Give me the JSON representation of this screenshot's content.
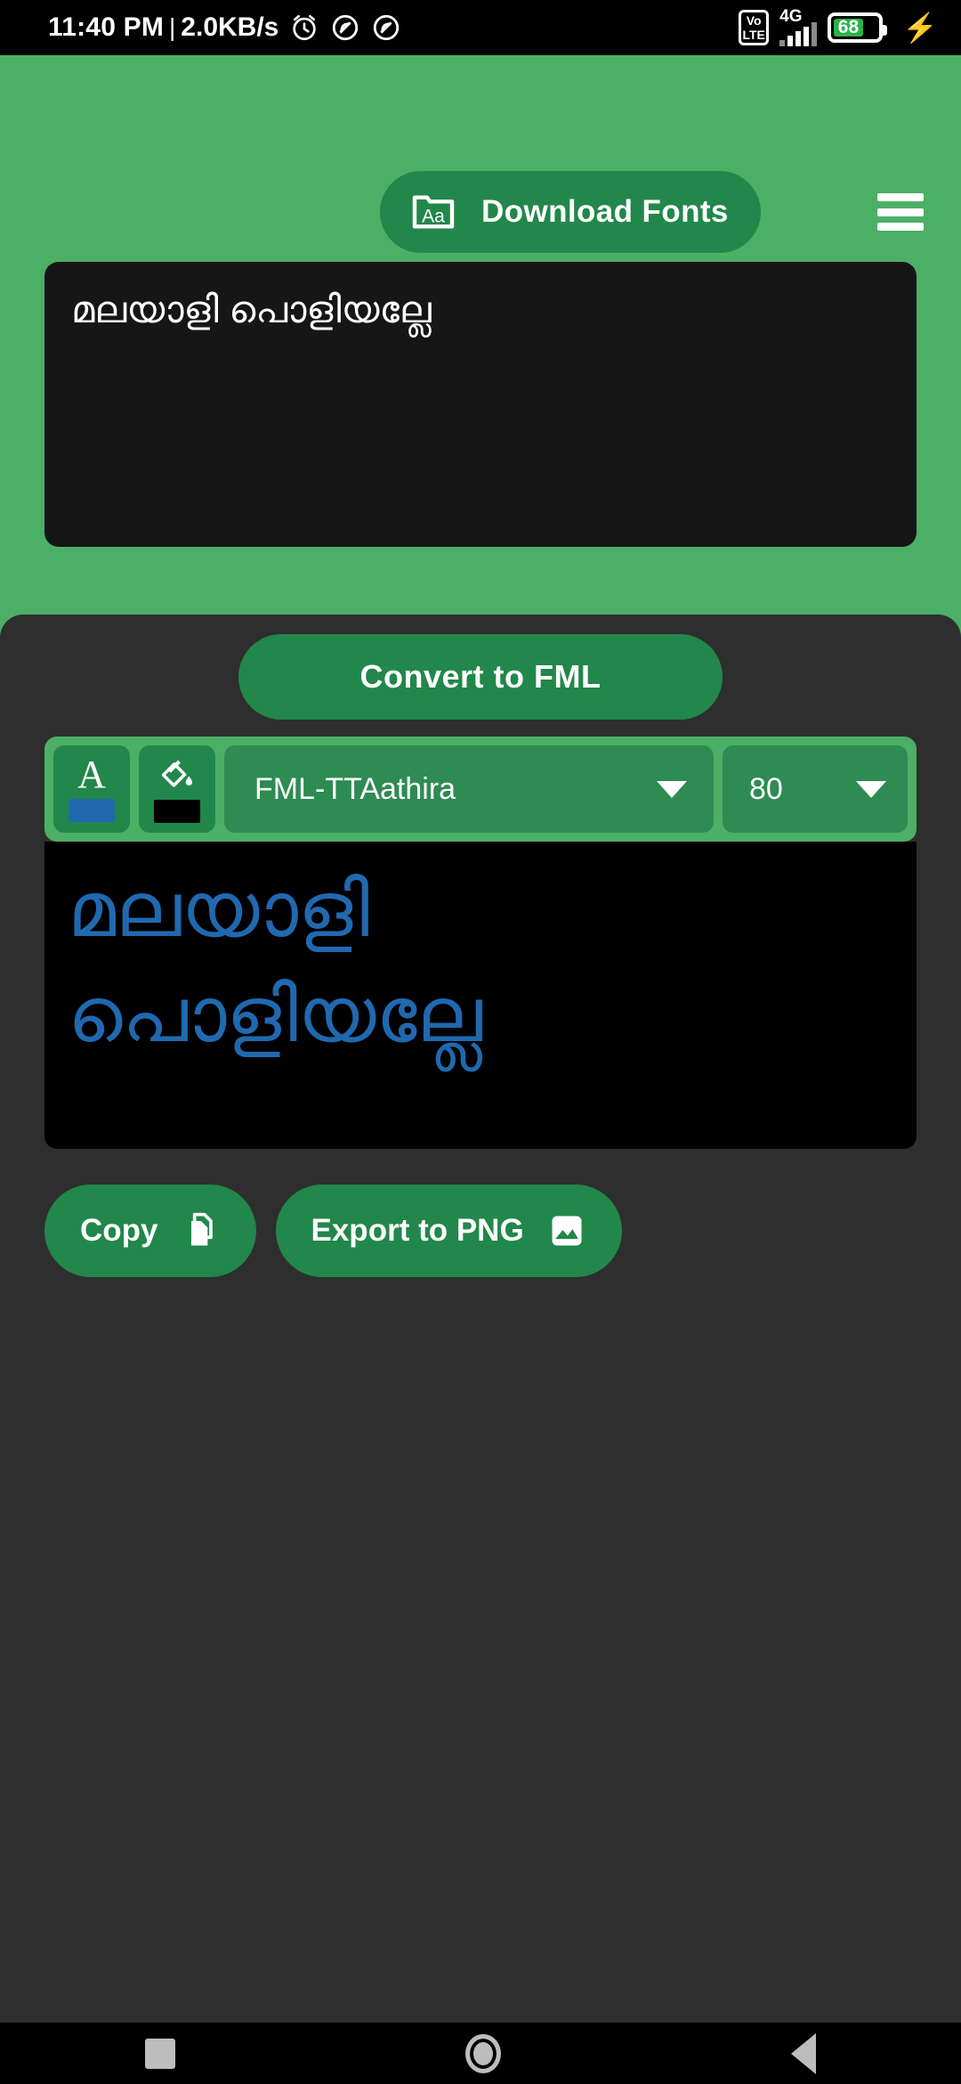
{
  "status_bar": {
    "clock": "11:40 PM",
    "separator": "|",
    "network_speed": "2.0KB/s",
    "icons": [
      "alarm-icon",
      "dnd-icon",
      "dnd-icon"
    ],
    "volte_top": "Vo",
    "volte_bottom": "LTE",
    "network_type": "4G",
    "battery_percent": "68",
    "charging": "charging-bolt-icon"
  },
  "header": {
    "download_fonts_label": "Download Fonts",
    "download_fonts_icon": "font-folder-aa-icon",
    "menu_icon": "hamburger-menu-icon"
  },
  "input": {
    "value": "മലയാളി പൊളിയല്ലേ",
    "placeholder": ""
  },
  "convert": {
    "label": "Convert to FML"
  },
  "toolbar": {
    "text_color_glyph": "A",
    "text_color_value": "#2069b0",
    "fill_color_icon": "paint-bucket-icon",
    "fill_color_value": "#000000",
    "font_name": "FML-TTAathira",
    "font_size": "80",
    "caret_icon": "chevron-down-icon"
  },
  "preview": {
    "line1": "മലയാളി",
    "line2": "പൊളിയല്ലേ",
    "text_color": "#2069b0",
    "background": "#000000"
  },
  "actions": {
    "copy_label": "Copy",
    "copy_icon": "copy-icon",
    "export_label": "Export to PNG",
    "export_icon": "image-icon"
  },
  "nav_bar": {
    "recents": "recents-square-icon",
    "home": "home-circle-icon",
    "back": "back-triangle-icon"
  },
  "theme": {
    "green_bg": "#4caf66",
    "green_dark": "#22874a",
    "panel_dark": "#2e2e2e",
    "input_dark": "#161616"
  }
}
